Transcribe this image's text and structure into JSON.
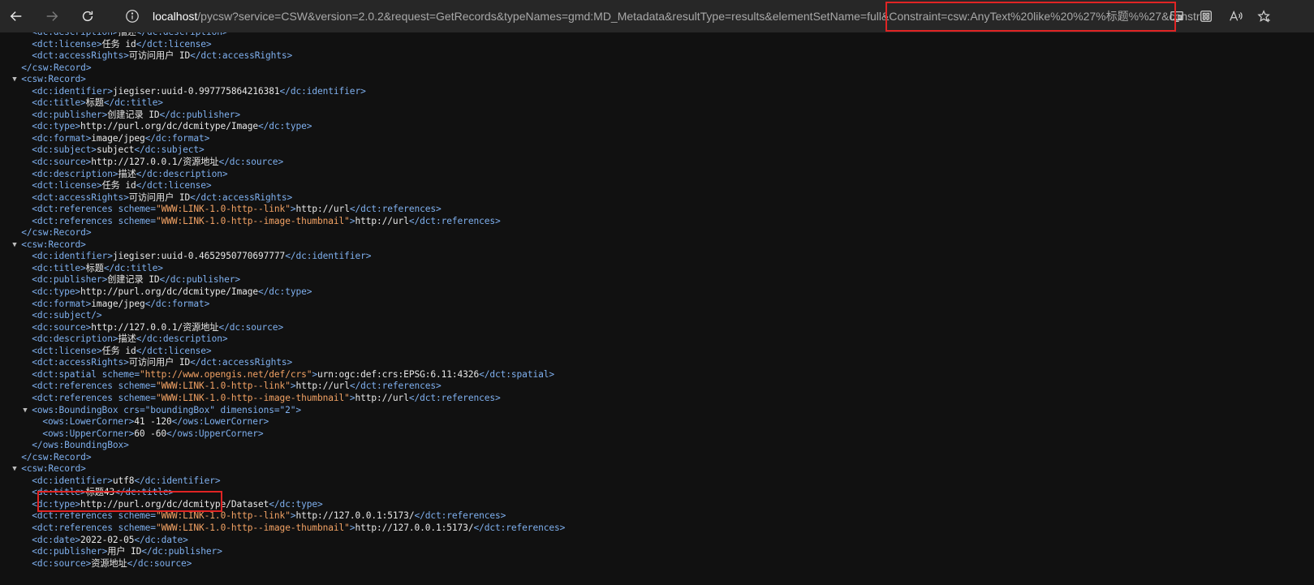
{
  "browser": {
    "url_host": "localhost",
    "url_rest": "/pycsw?service=CSW&version=2.0.2&request=GetRecords&typeNames=gmd:MD_Metadata&resultType=results&elementSetName=full&Constraint=csw:AnyText%20like%20%27%标题%%27&constr...",
    "icons": [
      "back-arrow-icon",
      "forward-arrow-icon",
      "refresh-icon",
      "info-icon",
      "cast-icon",
      "apps-icon",
      "read-aloud-icon",
      "favorites-icon"
    ]
  },
  "xml_lines": [
    {
      "indent": 3,
      "tag": "dc:description",
      "text": "描述",
      "partial": true
    },
    {
      "indent": 3,
      "tag": "dct:license",
      "text": "任务 id"
    },
    {
      "indent": 3,
      "tag": "dct:accessRights",
      "text": "可访问用户 ID"
    },
    {
      "indent": 2,
      "close": "csw:Record"
    },
    {
      "indent": 2,
      "open": "csw:Record",
      "arrow": true
    },
    {
      "indent": 3,
      "tag": "dc:identifier",
      "text": "jiegiser:uuid-0.997775864216381"
    },
    {
      "indent": 3,
      "tag": "dc:title",
      "text": "标题"
    },
    {
      "indent": 3,
      "tag": "dc:publisher",
      "text": "创建记录 ID"
    },
    {
      "indent": 3,
      "tag": "dc:type",
      "text": "http://purl.org/dc/dcmitype/Image"
    },
    {
      "indent": 3,
      "tag": "dc:format",
      "text": "image/jpeg"
    },
    {
      "indent": 3,
      "tag": "dc:subject",
      "text": "subject"
    },
    {
      "indent": 3,
      "tag": "dc:source",
      "text": "http://127.0.0.1/资源地址"
    },
    {
      "indent": 3,
      "tag": "dc:description",
      "text": "描述"
    },
    {
      "indent": 3,
      "tag": "dct:license",
      "text": "任务 id"
    },
    {
      "indent": 3,
      "tag": "dct:accessRights",
      "text": "可访问用户 ID"
    },
    {
      "indent": 3,
      "tag": "dct:references",
      "attr": "scheme",
      "attrval": "WWW:LINK-1.0-http--link",
      "text": "http://url"
    },
    {
      "indent": 3,
      "tag": "dct:references",
      "attr": "scheme",
      "attrval": "WWW:LINK-1.0-http--image-thumbnail",
      "text": "http://url"
    },
    {
      "indent": 2,
      "close": "csw:Record"
    },
    {
      "indent": 2,
      "open": "csw:Record",
      "arrow": true
    },
    {
      "indent": 3,
      "tag": "dc:identifier",
      "text": "jiegiser:uuid-0.4652950770697777"
    },
    {
      "indent": 3,
      "tag": "dc:title",
      "text": "标题"
    },
    {
      "indent": 3,
      "tag": "dc:publisher",
      "text": "创建记录 ID"
    },
    {
      "indent": 3,
      "tag": "dc:type",
      "text": "http://purl.org/dc/dcmitype/Image"
    },
    {
      "indent": 3,
      "tag": "dc:format",
      "text": "image/jpeg"
    },
    {
      "indent": 3,
      "selfclose": "dc:subject"
    },
    {
      "indent": 3,
      "tag": "dc:source",
      "text": "http://127.0.0.1/资源地址"
    },
    {
      "indent": 3,
      "tag": "dc:description",
      "text": "描述"
    },
    {
      "indent": 3,
      "tag": "dct:license",
      "text": "任务 id"
    },
    {
      "indent": 3,
      "tag": "dct:accessRights",
      "text": "可访问用户 ID"
    },
    {
      "indent": 3,
      "tag": "dct:spatial",
      "attr": "scheme",
      "attrval": "http://www.opengis.net/def/crs",
      "text": "urn:ogc:def:crs:EPSG:6.11:4326"
    },
    {
      "indent": 3,
      "tag": "dct:references",
      "attr": "scheme",
      "attrval": "WWW:LINK-1.0-http--link",
      "text": "http://url"
    },
    {
      "indent": 3,
      "tag": "dct:references",
      "attr": "scheme",
      "attrval": "WWW:LINK-1.0-http--image-thumbnail",
      "text": "http://url"
    },
    {
      "indent": 3,
      "open": "ows:BoundingBox",
      "arrow": true,
      "rawattrs": " crs=\"boundingBox\" dimensions=\"2\""
    },
    {
      "indent": 4,
      "tag": "ows:LowerCorner",
      "text": "41 -120"
    },
    {
      "indent": 4,
      "tag": "ows:UpperCorner",
      "text": "60 -60"
    },
    {
      "indent": 3,
      "close": "ows:BoundingBox"
    },
    {
      "indent": 2,
      "close": "csw:Record"
    },
    {
      "indent": 2,
      "open": "csw:Record",
      "arrow": true
    },
    {
      "indent": 3,
      "tag": "dc:identifier",
      "text": "utf8"
    },
    {
      "indent": 3,
      "tag": "dc:title",
      "text": "标题43"
    },
    {
      "indent": 3,
      "tag": "dc:type",
      "text": "http://purl.org/dc/dcmitype/Dataset"
    },
    {
      "indent": 3,
      "tag": "dct:references",
      "attr": "scheme",
      "attrval": "WWW:LINK-1.0-http--link",
      "text": "http://127.0.0.1:5173/"
    },
    {
      "indent": 3,
      "tag": "dct:references",
      "attr": "scheme",
      "attrval": "WWW:LINK-1.0-http--image-thumbnail",
      "text": "http://127.0.0.1:5173/"
    },
    {
      "indent": 3,
      "tag": "dc:date",
      "text": "2022-02-05"
    },
    {
      "indent": 3,
      "tag": "dc:publisher",
      "text": "用户 ID"
    },
    {
      "indent": 3,
      "tag": "dc:source",
      "text": "资源地址"
    }
  ],
  "colors": {
    "tag": "#7fb0ef",
    "attr_value": "#f2a264",
    "text": "#e8e8e8",
    "highlight": "#e02424",
    "background": "#111111",
    "toolbar": "#272727"
  }
}
